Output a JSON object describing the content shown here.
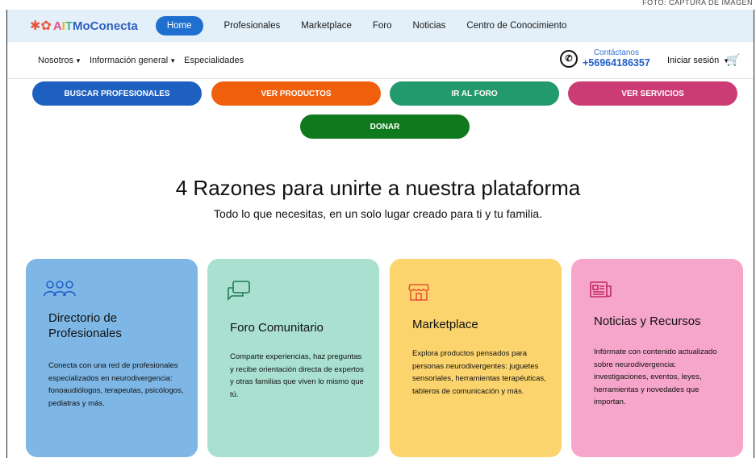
{
  "caption": "FOTO: CAPTURA DE IMAGEN",
  "logo": {
    "icons": "✱✿",
    "a": "A",
    "t": "I",
    "e": "T",
    "rest": "MoConecta"
  },
  "nav": {
    "home": "Home",
    "profesionales": "Profesionales",
    "marketplace": "Marketplace",
    "foro": "Foro",
    "noticias": "Noticias",
    "centro": "Centro de Conocimiento"
  },
  "subnav": {
    "nosotros": "Nosotros",
    "informacion": "Información general",
    "especialidades": "Especialidades",
    "contact_label": "Contáctanos",
    "contact_phone": "+56964186357",
    "login": "Iniciar sesión"
  },
  "actions": {
    "buscar": "BUSCAR PROFESIONALES",
    "productos": "VER PRODUCTOS",
    "foro": "IR AL FORO",
    "servicios": "VER SERVICIOS",
    "donar": "DONAR"
  },
  "headline": "4 Razones para unirte a nuestra plataforma",
  "subheadline": "Todo lo que necesitas, en un solo lugar creado para ti y tu familia.",
  "cards": [
    {
      "icon": "users-icon",
      "title": "Directorio de Profesionales",
      "body": "Conecta con una red de profesionales especializados en neurodivergencia: fonoaudiólogos, terapeutas, psicólogos, pediatras y más."
    },
    {
      "icon": "chat-icon",
      "title": "Foro Comunitario",
      "body": "Comparte experiencias, haz preguntas y recibe orientación directa de expertos y otras familias que viven lo mismo que tú."
    },
    {
      "icon": "store-icon",
      "title": "Marketplace",
      "body": "Explora productos pensados para personas neurodivergentes: juguetes sensoriales, herramientas terapéuticas, tableros de comunicación y más."
    },
    {
      "icon": "news-icon",
      "title": "Noticias y Recursos",
      "body": "Infórmate con contenido actualizado sobre neurodivergencia: investigaciones, eventos, leyes, herramientas y novedades que importan."
    }
  ]
}
